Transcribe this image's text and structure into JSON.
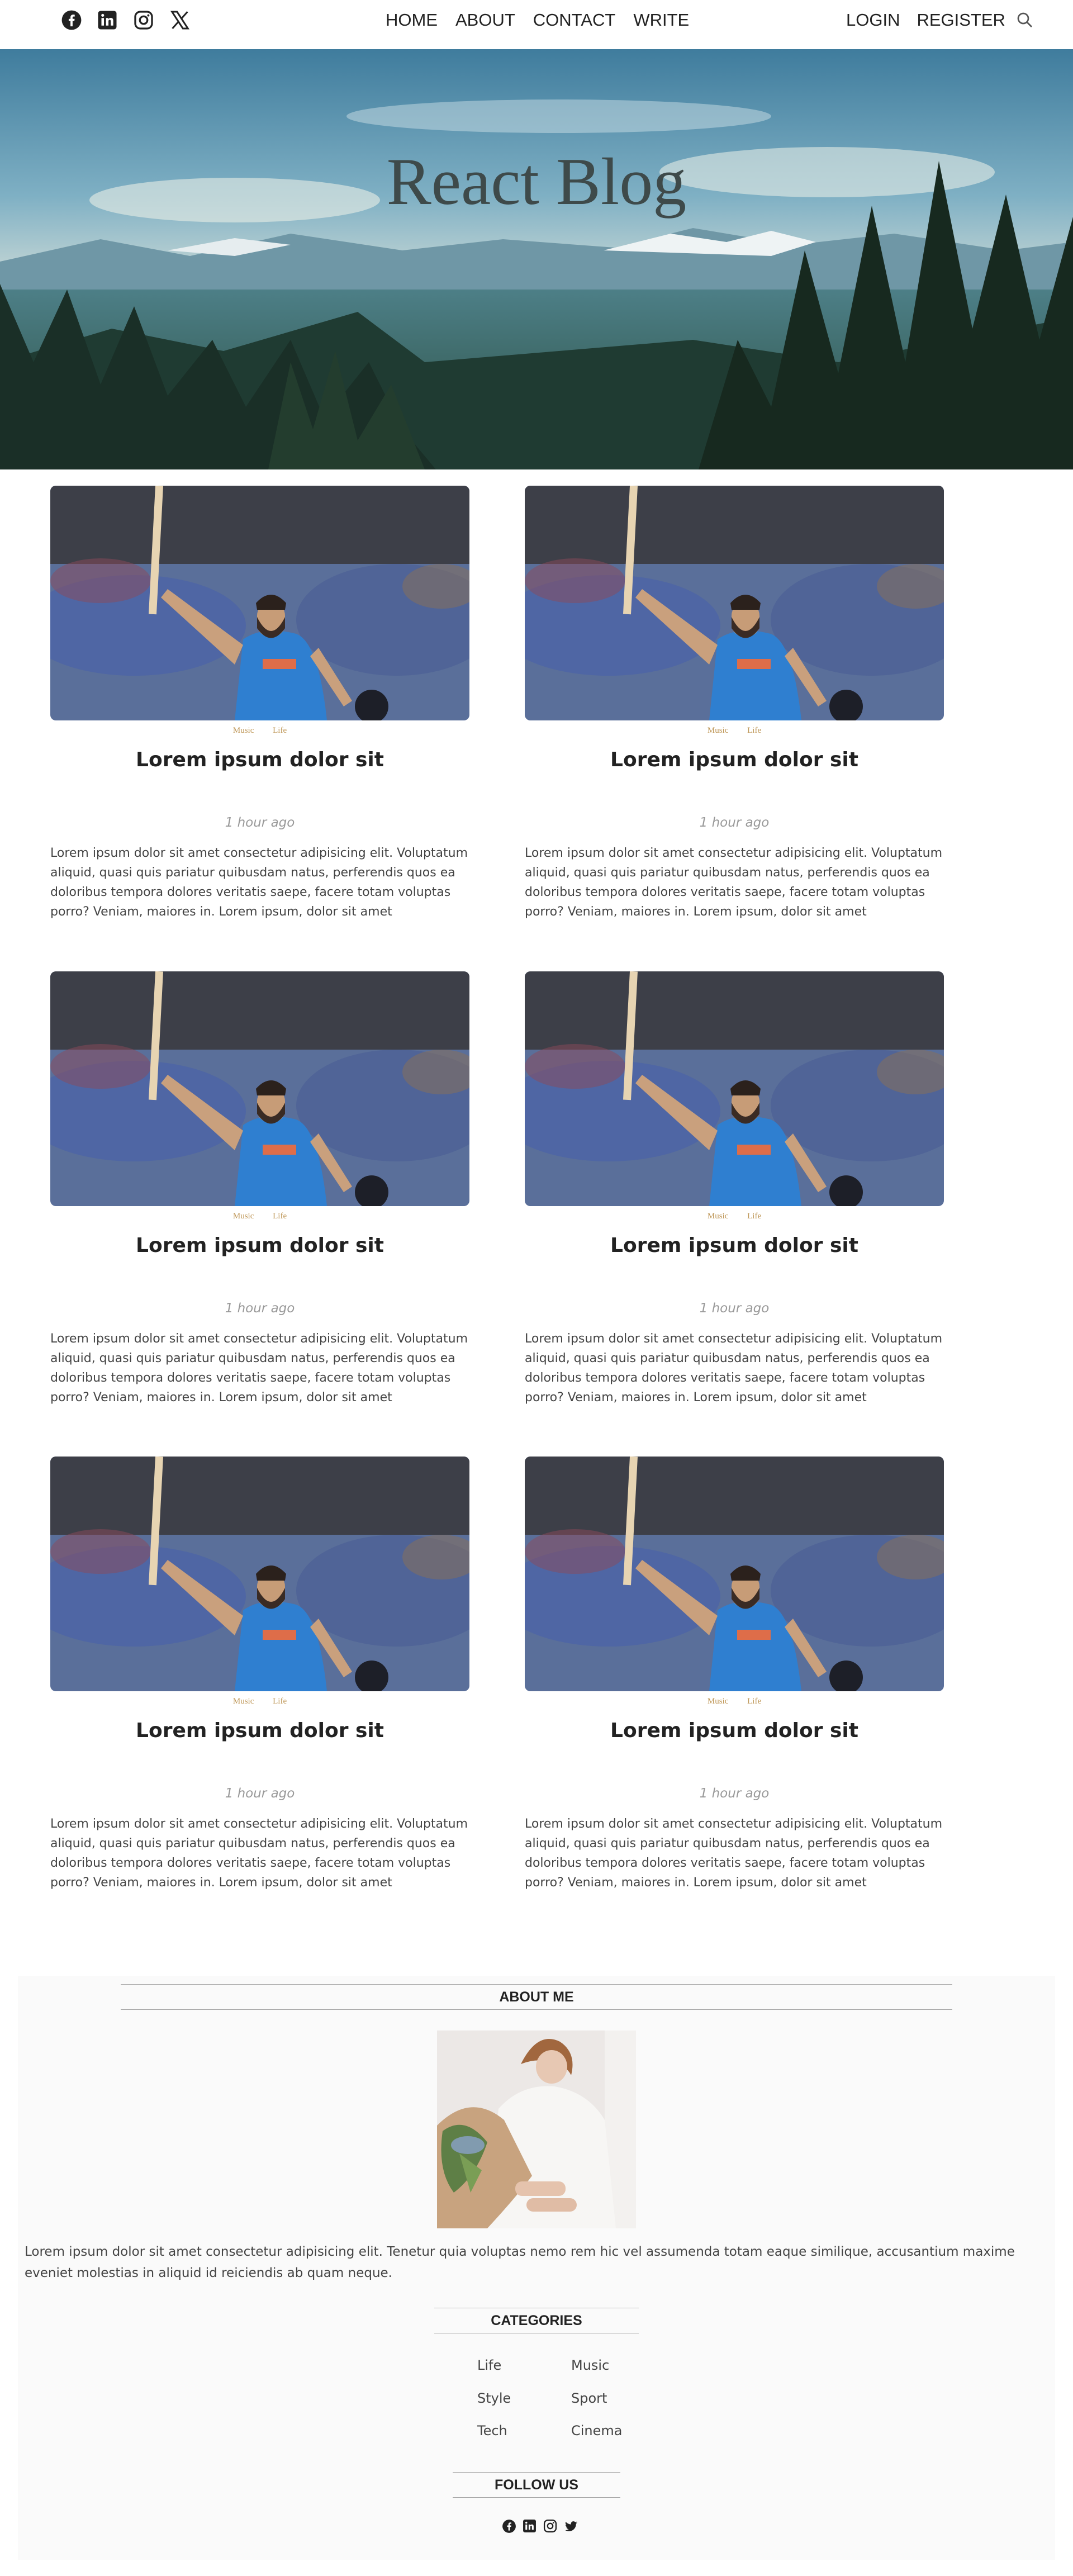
{
  "nav": {
    "social_icons": [
      "facebook-icon",
      "linkedin-icon",
      "instagram-icon",
      "x-icon"
    ],
    "links": [
      "HOME",
      "ABOUT",
      "CONTACT",
      "WRITE"
    ],
    "right_links": [
      "LOGIN",
      "REGISTER"
    ],
    "search_icon": "search-icon"
  },
  "hero": {
    "title": "React Blog"
  },
  "posts": [
    {
      "cats": [
        "Music",
        "Life"
      ],
      "title": "Lorem ipsum dolor sit",
      "date": "1 hour ago",
      "desc": "Lorem ipsum dolor sit amet consectetur adipisicing elit. Voluptatum aliquid, quasi quis pariatur quibusdam natus, perferendis quos ea doloribus tempora dolores veritatis saepe, facere totam voluptas porro? Veniam, maiores in. Lorem ipsum, dolor sit amet consectetur..."
    },
    {
      "cats": [
        "Music",
        "Life"
      ],
      "title": "Lorem ipsum dolor sit",
      "date": "1 hour ago",
      "desc": "Lorem ipsum dolor sit amet consectetur adipisicing elit. Voluptatum aliquid, quasi quis pariatur quibusdam natus, perferendis quos ea doloribus tempora dolores veritatis saepe, facere totam voluptas porro? Veniam, maiores in. Lorem ipsum, dolor sit amet consectetur..."
    },
    {
      "cats": [
        "Music",
        "Life"
      ],
      "title": "Lorem ipsum dolor sit",
      "date": "1 hour ago",
      "desc": "Lorem ipsum dolor sit amet consectetur adipisicing elit. Voluptatum aliquid, quasi quis pariatur quibusdam natus, perferendis quos ea doloribus tempora dolores veritatis saepe, facere totam voluptas porro? Veniam, maiores in. Lorem ipsum, dolor sit amet consectetur..."
    },
    {
      "cats": [
        "Music",
        "Life"
      ],
      "title": "Lorem ipsum dolor sit",
      "date": "1 hour ago",
      "desc": "Lorem ipsum dolor sit amet consectetur adipisicing elit. Voluptatum aliquid, quasi quis pariatur quibusdam natus, perferendis quos ea doloribus tempora dolores veritatis saepe, facere totam voluptas porro? Veniam, maiores in. Lorem ipsum, dolor sit amet consectetur..."
    },
    {
      "cats": [
        "Music",
        "Life"
      ],
      "title": "Lorem ipsum dolor sit",
      "date": "1 hour ago",
      "desc": "Lorem ipsum dolor sit amet consectetur adipisicing elit. Voluptatum aliquid, quasi quis pariatur quibusdam natus, perferendis quos ea doloribus tempora dolores veritatis saepe, facere totam voluptas porro? Veniam, maiores in. Lorem ipsum, dolor sit amet consectetur..."
    },
    {
      "cats": [
        "Music",
        "Life"
      ],
      "title": "Lorem ipsum dolor sit",
      "date": "1 hour ago",
      "desc": "Lorem ipsum dolor sit amet consectetur adipisicing elit. Voluptatum aliquid, quasi quis pariatur quibusdam natus, perferendis quos ea doloribus tempora dolores veritatis saepe, facere totam voluptas porro? Veniam, maiores in. Lorem ipsum, dolor sit amet consectetur..."
    }
  ],
  "sidebar": {
    "about_title": "ABOUT ME",
    "about_text": "Lorem ipsum dolor sit amet consectetur adipisicing elit. Tenetur quia voluptas nemo rem hic vel assumenda totam eaque similique, accusantium maxime eveniet molestias in aliquid id reiciendis ab quam neque.",
    "categories_title": "CATEGORIES",
    "categories": [
      "Life",
      "Music",
      "Style",
      "Sport",
      "Tech",
      "Cinema"
    ],
    "follow_title": "FOLLOW US",
    "follow_icons": [
      "facebook-icon",
      "linkedin-icon",
      "instagram-icon",
      "twitter-icon"
    ]
  },
  "colors": {
    "accent": "#be9656",
    "sidebar_bg": "#fafafa",
    "text": "#222222",
    "muted": "#999999"
  }
}
